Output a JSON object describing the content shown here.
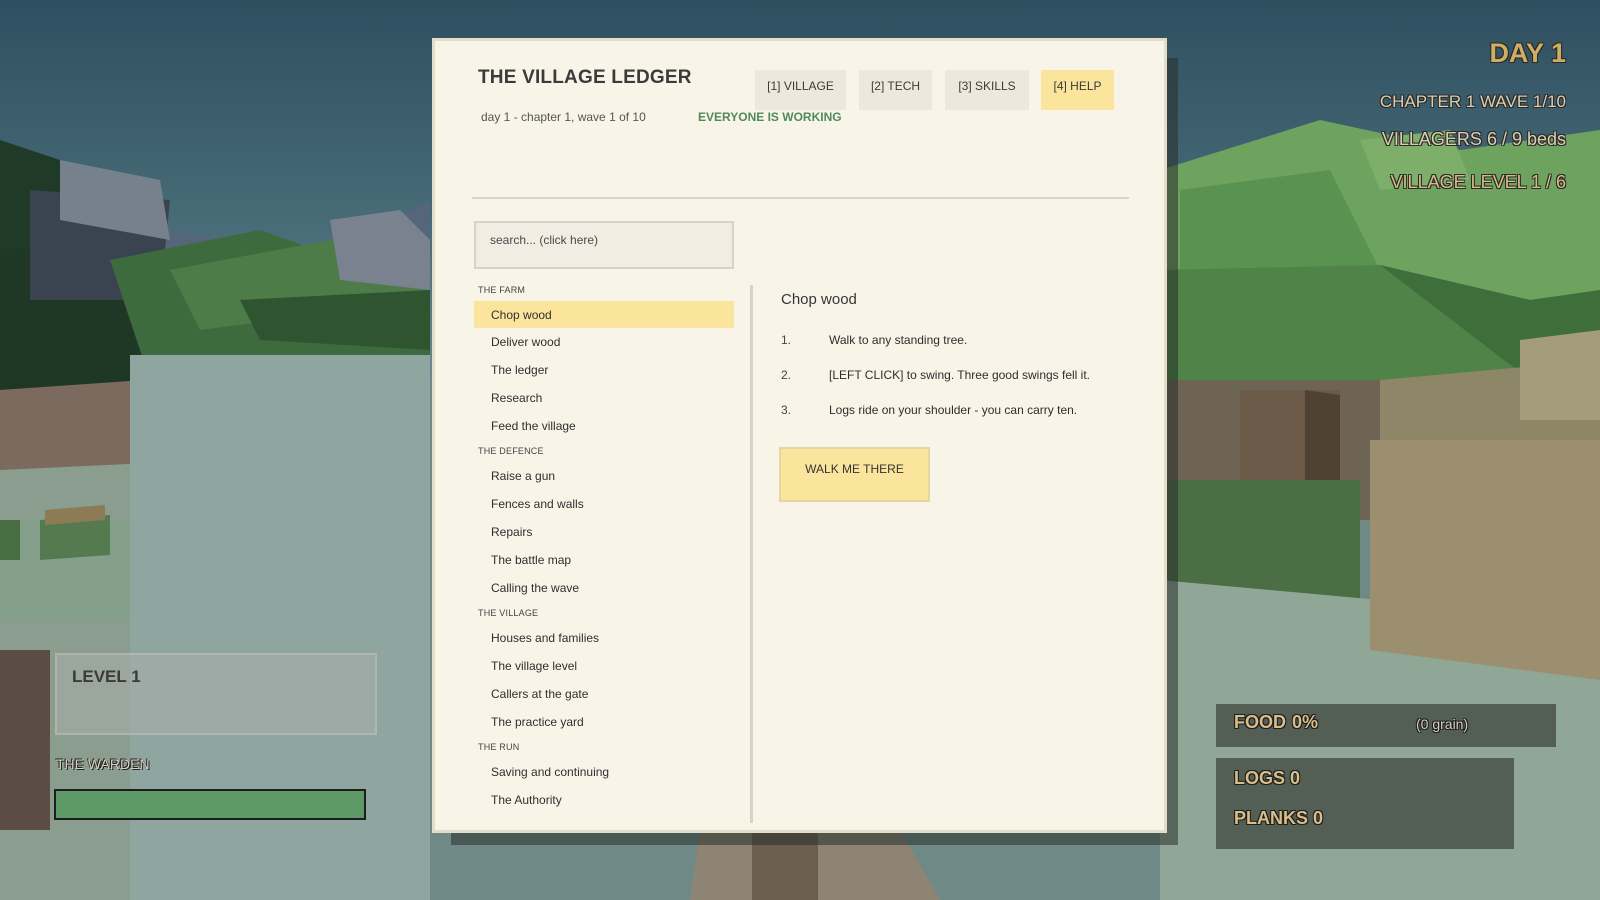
{
  "hud": {
    "day": "DAY 1",
    "chapter_wave": "CHAPTER 1   WAVE 1/10",
    "villagers": "VILLAGERS 6 / 9 beds",
    "village_level": "VILLAGE  LEVEL 1 / 6",
    "player_level": "LEVEL 1",
    "player_name": "THE WARDEN",
    "health_fraction": 1.0,
    "food_label": "FOOD",
    "food_value": "0%",
    "grain": "(0 grain)",
    "logs_label": "LOGS",
    "logs_value": "0",
    "planks_label": "PLANKS",
    "planks_value": "0"
  },
  "ledger": {
    "title": "THE VILLAGE LEDGER",
    "subtitle": "day 1  -  chapter 1, wave 1 of 10",
    "status": "EVERYONE IS WORKING",
    "tabs": [
      {
        "label": "[1] VILLAGE",
        "active": false
      },
      {
        "label": "[2] TECH",
        "active": false
      },
      {
        "label": "[3] SKILLS",
        "active": false
      },
      {
        "label": "[4] HELP",
        "active": true
      }
    ],
    "search_placeholder": "search...  (click here)",
    "sections": [
      {
        "name": "THE FARM",
        "topics": [
          "Chop wood",
          "Deliver wood",
          "The ledger",
          "Research",
          "Feed the village"
        ]
      },
      {
        "name": "THE DEFENCE",
        "topics": [
          "Raise a gun",
          "Fences and walls",
          "Repairs",
          "The battle map",
          "Calling the wave"
        ]
      },
      {
        "name": "THE VILLAGE",
        "topics": [
          "Houses and families",
          "The village level",
          "Callers at the gate",
          "The practice yard"
        ]
      },
      {
        "name": "THE RUN",
        "topics": [
          "Saving and continuing",
          "The Authority"
        ]
      }
    ],
    "selected_topic": "Chop wood",
    "detail": {
      "title": "Chop wood",
      "steps": [
        {
          "num": "1.",
          "text": "Walk to any standing tree."
        },
        {
          "num": "2.",
          "text": "[LEFT CLICK] to swing. Three good swings fell it."
        },
        {
          "num": "3.",
          "text": "Logs ride on your shoulder - you can carry ten."
        }
      ],
      "action_label": "WALK ME THERE"
    }
  },
  "colors": {
    "accent": "#fbe59d",
    "status_green": "#4f8a5a",
    "health_green": "#5e9a66"
  }
}
